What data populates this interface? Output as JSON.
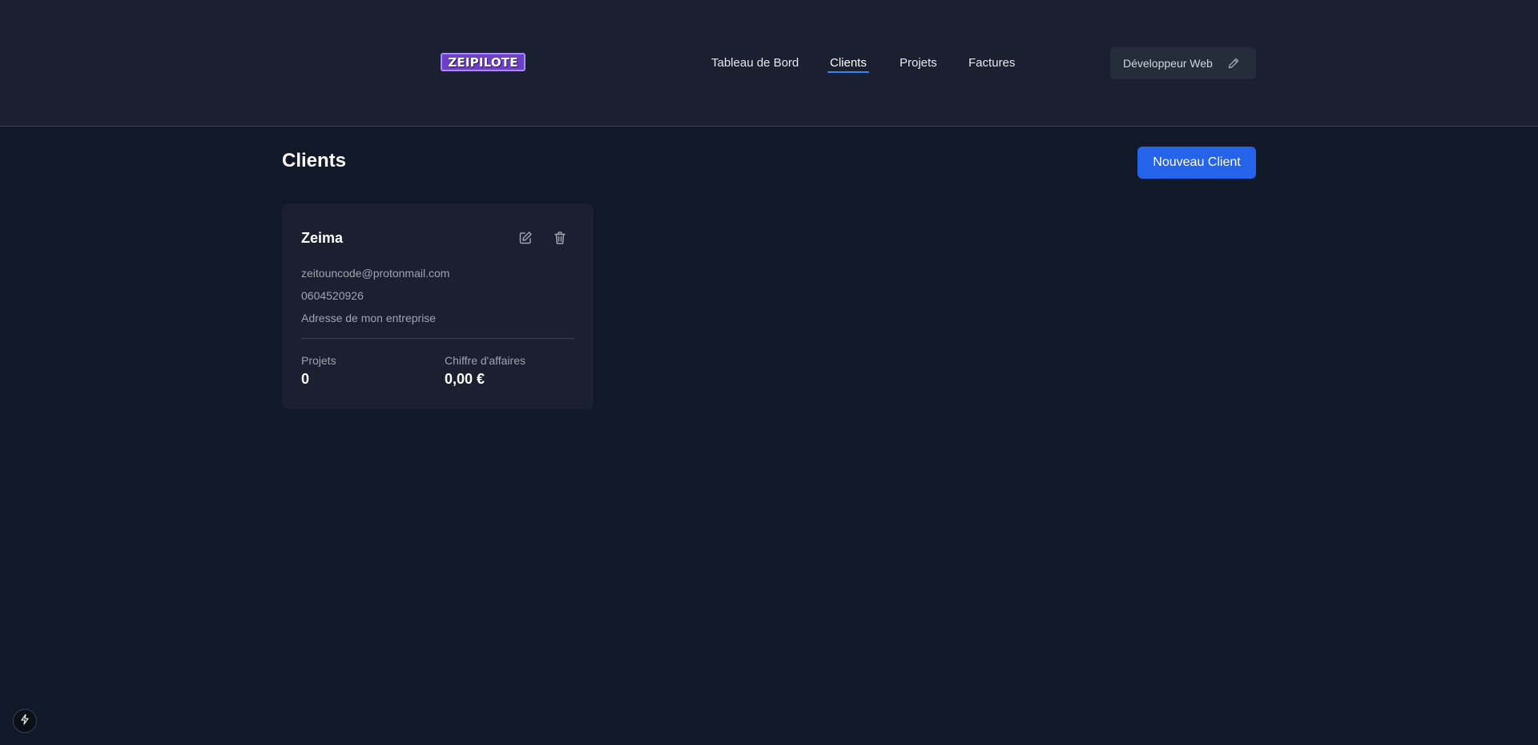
{
  "brand": {
    "logo_text": "ZEIPILOTE",
    "accent": "#6d3fc4"
  },
  "nav": {
    "items": [
      {
        "label": "Tableau de Bord",
        "active": false
      },
      {
        "label": "Clients",
        "active": true
      },
      {
        "label": "Projets",
        "active": false
      },
      {
        "label": "Factures",
        "active": false
      }
    ]
  },
  "profile": {
    "label": "Développeur Web",
    "icon": "pencil-icon"
  },
  "page": {
    "title": "Clients",
    "new_button_label": "Nouveau Client",
    "new_button_color": "#2563eb"
  },
  "clients": [
    {
      "name": "Zeima",
      "email": "zeitouncode@protonmail.com",
      "phone": "0604520926",
      "address": "Adresse de mon entreprise",
      "projects_label": "Projets",
      "projects_value": "0",
      "revenue_label": "Chiffre d'affaires",
      "revenue_value": "0,00 €"
    }
  ],
  "floating": {
    "icon": "bolt-icon"
  }
}
